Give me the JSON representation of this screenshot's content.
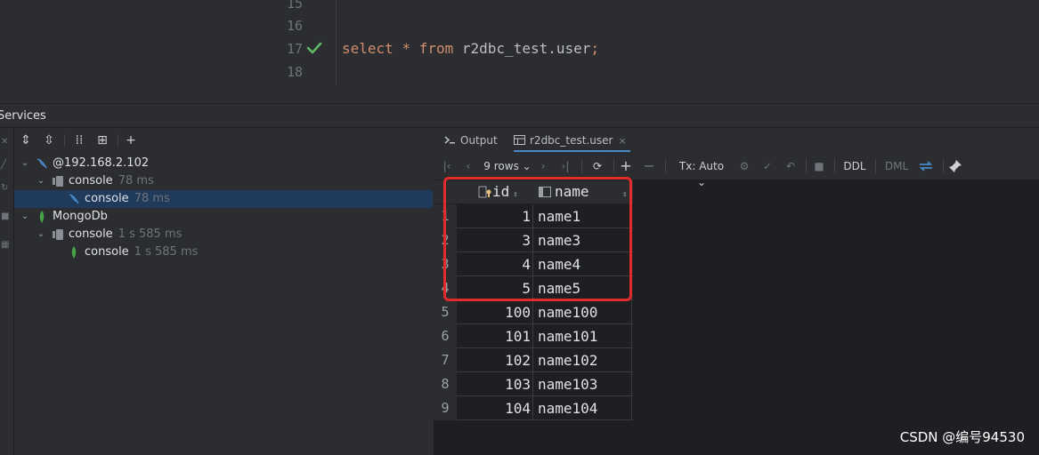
{
  "editor": {
    "line_numbers": [
      "15",
      "16",
      "17",
      "18"
    ],
    "code_line": {
      "kw1": "select",
      "star": "*",
      "kw2": "from",
      "target": "r2dbc_test.user",
      "semi": ";"
    }
  },
  "services": {
    "title": "Services",
    "tree": [
      {
        "label": "@192.168.2.102",
        "time": ""
      },
      {
        "label": "console",
        "time": "78 ms"
      },
      {
        "label": "console",
        "time": "78 ms"
      },
      {
        "label": "MongoDb",
        "time": ""
      },
      {
        "label": "console",
        "time": "1 s 585 ms"
      },
      {
        "label": "console",
        "time": "1 s 585 ms"
      }
    ]
  },
  "results": {
    "tabs": [
      {
        "label": "Output"
      },
      {
        "label": "r2dbc_test.user",
        "close": "×"
      }
    ],
    "toolbar": {
      "rows_label": "9 rows",
      "tx_label": "Tx: Auto",
      "ddl_label": "DDL",
      "dml_label": "DML"
    },
    "columns": [
      "id",
      "name"
    ],
    "rows": [
      {
        "n": "1",
        "id": "1",
        "name": "name1"
      },
      {
        "n": "2",
        "id": "3",
        "name": "name3"
      },
      {
        "n": "3",
        "id": "4",
        "name": "name4"
      },
      {
        "n": "4",
        "id": "5",
        "name": "name5"
      },
      {
        "n": "5",
        "id": "100",
        "name": "name100"
      },
      {
        "n": "6",
        "id": "101",
        "name": "name101"
      },
      {
        "n": "7",
        "id": "102",
        "name": "name102"
      },
      {
        "n": "8",
        "id": "103",
        "name": "name103"
      },
      {
        "n": "9",
        "id": "104",
        "name": "name104"
      }
    ]
  },
  "watermark": "CSDN @编号94530",
  "colors": {
    "highlight": "#e32b2b",
    "keyword": "#cf8e6d",
    "mongo": "#47a248",
    "mysql": "#4a88c7",
    "check": "#5fb865"
  }
}
